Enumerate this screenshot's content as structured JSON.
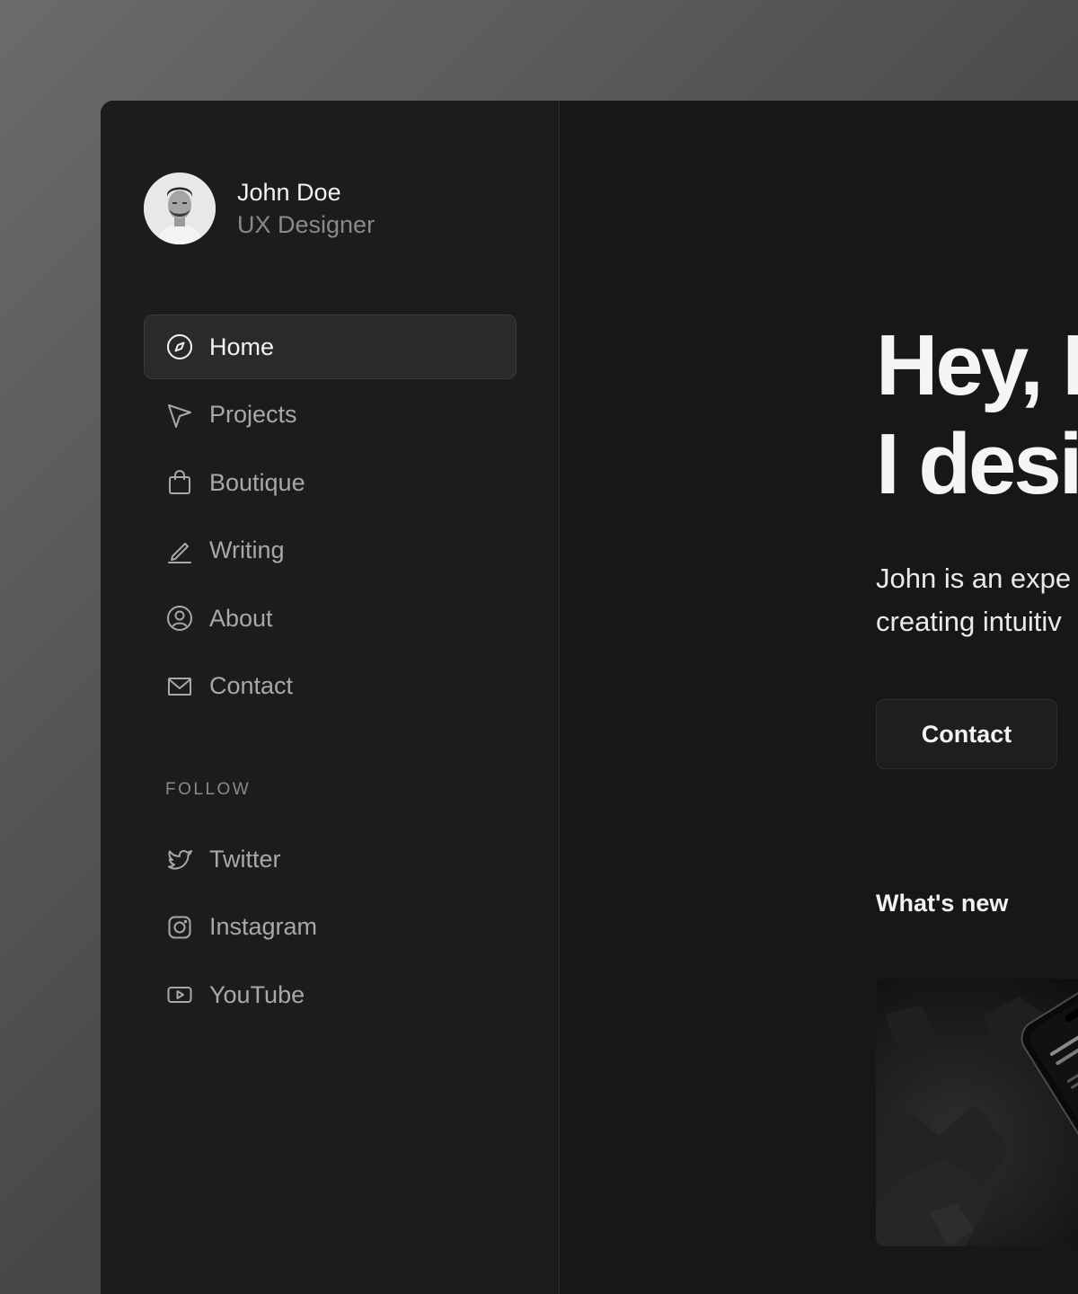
{
  "profile": {
    "name": "John Doe",
    "role": "UX Designer"
  },
  "nav": {
    "items": [
      {
        "label": "Home",
        "icon": "compass-icon",
        "active": true
      },
      {
        "label": "Projects",
        "icon": "cursor-arrow-icon",
        "active": false
      },
      {
        "label": "Boutique",
        "icon": "shopping-bag-icon",
        "active": false
      },
      {
        "label": "Writing",
        "icon": "pen-icon",
        "active": false
      },
      {
        "label": "About",
        "icon": "user-circle-icon",
        "active": false
      },
      {
        "label": "Contact",
        "icon": "mail-icon",
        "active": false
      }
    ]
  },
  "follow": {
    "heading": "FOLLOW",
    "items": [
      {
        "label": "Twitter",
        "icon": "twitter-icon"
      },
      {
        "label": "Instagram",
        "icon": "instagram-icon"
      },
      {
        "label": "YouTube",
        "icon": "youtube-icon"
      }
    ]
  },
  "hero": {
    "line1": "Hey, I",
    "line2": "I desi"
  },
  "intro": {
    "line1": "John is an expe",
    "line2": "creating intuitiv"
  },
  "contact_button": {
    "label": "Contact"
  },
  "whats_new": {
    "heading": "What's new"
  },
  "colors": {
    "background": "#1c1c1c",
    "main": "#171717",
    "text": "#f2f2f2",
    "muted": "#a8a8a8"
  }
}
